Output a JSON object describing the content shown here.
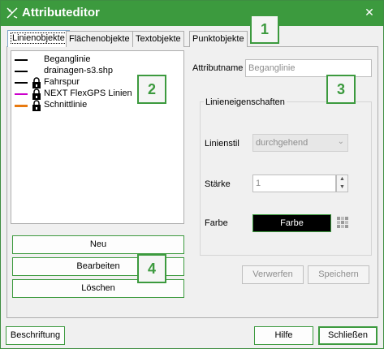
{
  "window": {
    "title": "Attributeditor"
  },
  "tabs": [
    {
      "label": "Linienobjekte",
      "active": true
    },
    {
      "label": "Flächenobjekte"
    },
    {
      "label": "Textobjekte"
    },
    {
      "label": "Punktobjekte"
    }
  ],
  "list": {
    "items": [
      {
        "label": "Beganglinie",
        "line_color": "#000000",
        "locked": false
      },
      {
        "label": "drainagen-s3.shp",
        "line_color": "#000000",
        "locked": false
      },
      {
        "label": "Fahrspur",
        "line_color": "#000000",
        "locked": true
      },
      {
        "label": "NEXT FlexGPS Linien",
        "line_color": "#cc00cc",
        "locked": true
      },
      {
        "label": "Schnittlinie",
        "line_color": "#e87a10",
        "locked": true
      }
    ]
  },
  "buttons": {
    "neu": "Neu",
    "bearbeiten": "Bearbeiten",
    "loeschen": "Löschen",
    "verwerfen": "Verwerfen",
    "speichern": "Speichern",
    "beschriftung": "Beschriftung",
    "hilfe": "Hilfe",
    "schliessen": "Schließen"
  },
  "attributes": {
    "name_label": "Attributname",
    "name_value": "Beganglinie",
    "group_title": "Linieneigenschaften",
    "linestyle_label": "Linienstil",
    "linestyle_value": "durchgehend",
    "strength_label": "Stärke",
    "strength_value": "1",
    "color_label": "Farbe",
    "color_button": "Farbe"
  },
  "callouts": [
    "1",
    "2",
    "3",
    "4"
  ],
  "colors": {
    "accent": "#3c9a3e"
  }
}
